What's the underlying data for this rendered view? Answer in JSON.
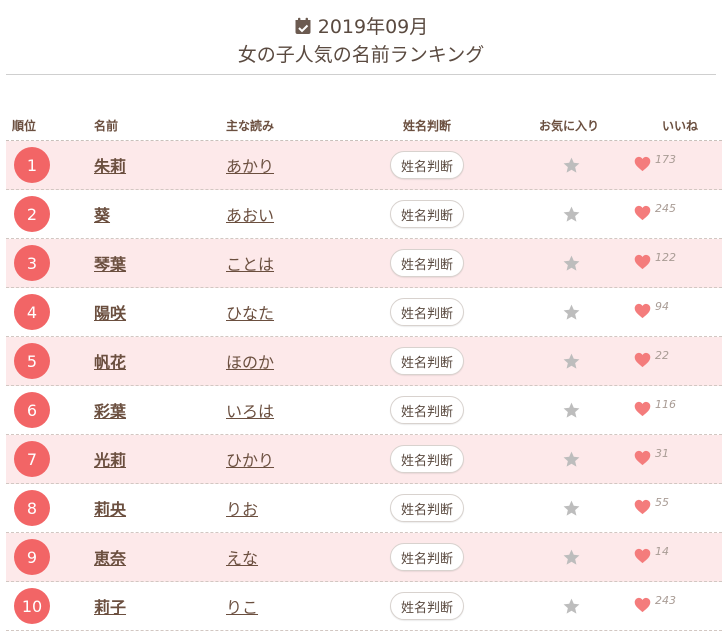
{
  "header": {
    "date": "2019年09月",
    "title": "女の子人気の名前ランキング"
  },
  "columns": {
    "rank": "順位",
    "name": "名前",
    "reading": "主な読み",
    "judge": "姓名判断",
    "favorite": "お気に入り",
    "like": "いいね"
  },
  "rows": [
    {
      "rank": "1",
      "name": "朱莉",
      "reading": "あかり",
      "judge": "姓名判断",
      "likes": "173"
    },
    {
      "rank": "2",
      "name": "葵",
      "reading": "あおい",
      "judge": "姓名判断",
      "likes": "245"
    },
    {
      "rank": "3",
      "name": "琴葉",
      "reading": "ことは",
      "judge": "姓名判断",
      "likes": "122"
    },
    {
      "rank": "4",
      "name": "陽咲",
      "reading": "ひなた",
      "judge": "姓名判断",
      "likes": "94"
    },
    {
      "rank": "5",
      "name": "帆花",
      "reading": "ほのか",
      "judge": "姓名判断",
      "likes": "22"
    },
    {
      "rank": "6",
      "name": "彩葉",
      "reading": "いろは",
      "judge": "姓名判断",
      "likes": "116"
    },
    {
      "rank": "7",
      "name": "光莉",
      "reading": "ひかり",
      "judge": "姓名判断",
      "likes": "31"
    },
    {
      "rank": "8",
      "name": "莉央",
      "reading": "りお",
      "judge": "姓名判断",
      "likes": "55"
    },
    {
      "rank": "9",
      "name": "恵奈",
      "reading": "えな",
      "judge": "姓名判断",
      "likes": "14"
    },
    {
      "rank": "10",
      "name": "莉子",
      "reading": "りこ",
      "judge": "姓名判断",
      "likes": "243"
    }
  ],
  "icons": {
    "calendar": "calendar-check-icon",
    "favorite": "star-icon",
    "like": "heart-icon"
  },
  "colors": {
    "accent": "#f26566",
    "row_alt_bg": "#fde9ea",
    "text": "#6b4f3f",
    "star": "#bdbdbd",
    "heart": "#f47c7c"
  }
}
